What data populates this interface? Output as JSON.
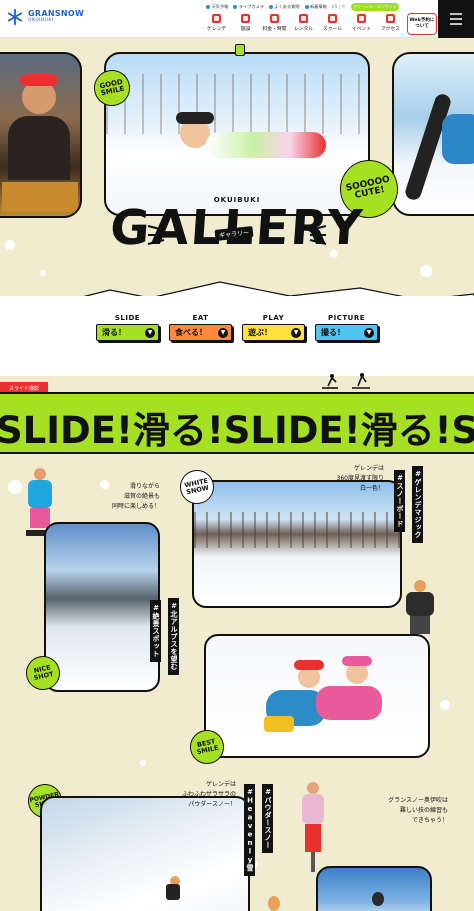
{
  "header": {
    "logo_main": "GRANSNOW",
    "logo_sub": "OKUIBUKI",
    "util_links": [
      "天気予報",
      "ライブカメラ",
      "よくある質問",
      "新着情報"
    ],
    "lang": "EN | 中",
    "green_pill": "グリーンシーズンサイト",
    "web_reserve": [
      "Web予約に",
      "ついて"
    ],
    "nav": [
      "ゲレンデ",
      "施設",
      "料金・時間",
      "レンタル",
      "スクール",
      "イベント",
      "アクセス"
    ]
  },
  "hero": {
    "sticker_good_smile": [
      "GOOD",
      "SMILE"
    ],
    "sticker_soooo_cute": [
      "SOOOOO",
      "CUTE!"
    ]
  },
  "gallery": {
    "eyebrow": "OKUIBUKI",
    "title": "GALLERY",
    "kana": "ギャラリー"
  },
  "categories": [
    {
      "en": "SLIDE",
      "jp": "滑る！",
      "color": "#a6e022"
    },
    {
      "en": "EAT",
      "jp": "食べる！",
      "color": "#ff8a3d"
    },
    {
      "en": "PLAY",
      "jp": "遊ぶ！",
      "color": "#ffe13a"
    },
    {
      "en": "PICTURE",
      "jp": "撮る！",
      "color": "#4fc6f2"
    }
  ],
  "slide": {
    "label": "スライド撮影",
    "marquee": "SLIDE!滑る!SLIDE!滑る!SLIDE!"
  },
  "posts": {
    "caption1": "滑りながら\n滋賀の絶景も\n同時に楽しめる！",
    "caption2": "ゲレンデは\n360度見渡す限り\n白一色！",
    "caption3": "ゲレンデは\nふわふわサラサラの\nパウダースノー！",
    "caption4": "グランスノー奥伊吹は\n難しい技の練習も\nできちゃう！",
    "tag_snowboard": "#スノーボード",
    "tag_gelende_magic": "#ゲレンデマジック",
    "tag_kita_alps": "#北アルプスを望む",
    "tag_zekkei": "#絶景スポット",
    "tag_heavenly": "#Heavenly雪",
    "tag_powder": "#パウダースノー",
    "sticker_white_snow": [
      "WHITE",
      "SNOW"
    ],
    "sticker_nice_shot": [
      "NICE",
      "SHOT"
    ],
    "sticker_best_smile": [
      "BEST",
      "SMILE"
    ],
    "sticker_powder_snow": [
      "POWDER",
      "SNOW"
    ]
  },
  "colors": {
    "accent_green": "#a6e022",
    "accent_red": "#e8322f",
    "background": "#f1ebcf",
    "brand_blue": "#1b63c9"
  }
}
